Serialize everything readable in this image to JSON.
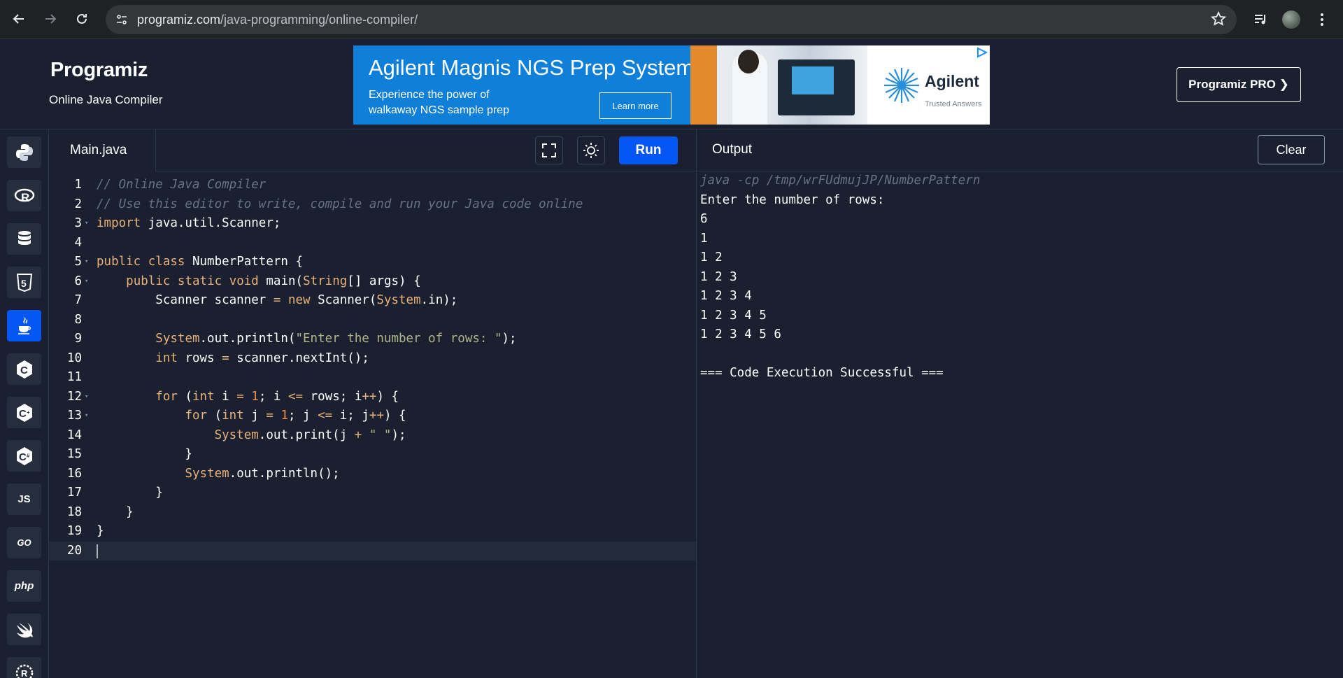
{
  "browser": {
    "url_host": "programiz.com",
    "url_path": "/java-programming/online-compiler/"
  },
  "header": {
    "logo": "Programiz",
    "subtitle": "Online Java Compiler",
    "pro_button": "Programiz PRO ❯"
  },
  "ad": {
    "title": "Agilent Magnis NGS Prep System",
    "sub_line1": "Experience the power of",
    "sub_line2": "walkaway NGS sample prep",
    "cta": "Learn more",
    "brand": "Agilent",
    "tagline": "Trusted Answers"
  },
  "sidebar": {
    "languages": [
      {
        "name": "python",
        "label": ""
      },
      {
        "name": "r",
        "label": "R"
      },
      {
        "name": "sql",
        "label": ""
      },
      {
        "name": "html",
        "label": "5"
      },
      {
        "name": "java",
        "label": ""
      },
      {
        "name": "c",
        "label": "C"
      },
      {
        "name": "cpp",
        "label": "C"
      },
      {
        "name": "csharp",
        "label": "C"
      },
      {
        "name": "javascript",
        "label": "JS"
      },
      {
        "name": "go",
        "label": "GO"
      },
      {
        "name": "php",
        "label": "php"
      },
      {
        "name": "swift",
        "label": ""
      },
      {
        "name": "rust",
        "label": "R"
      }
    ],
    "active": "java"
  },
  "editor": {
    "tab": "Main.java",
    "run_label": "Run",
    "lines": [
      [
        [
          "cm",
          "// Online Java Compiler"
        ]
      ],
      [
        [
          "cm",
          "// Use this editor to write, compile and run your Java code online"
        ]
      ],
      [
        [
          "kw",
          "import"
        ],
        [
          "pl",
          " java.util.Scanner;"
        ]
      ],
      [],
      [
        [
          "kw",
          "public"
        ],
        [
          "pl",
          " "
        ],
        [
          "kw",
          "class"
        ],
        [
          "pl",
          " NumberPattern {"
        ]
      ],
      [
        [
          "pl",
          "    "
        ],
        [
          "kw",
          "public"
        ],
        [
          "pl",
          " "
        ],
        [
          "kw",
          "static"
        ],
        [
          "pl",
          " "
        ],
        [
          "kw",
          "void"
        ],
        [
          "pl",
          " main("
        ],
        [
          "ty",
          "String"
        ],
        [
          "pl",
          "[] args) {"
        ]
      ],
      [
        [
          "pl",
          "        Scanner scanner "
        ],
        [
          "op",
          "="
        ],
        [
          "pl",
          " "
        ],
        [
          "kw",
          "new"
        ],
        [
          "pl",
          " Scanner("
        ],
        [
          "cls",
          "System"
        ],
        [
          "pl",
          ".in);"
        ]
      ],
      [],
      [
        [
          "pl",
          "        "
        ],
        [
          "cls",
          "System"
        ],
        [
          "pl",
          ".out.println("
        ],
        [
          "str",
          "\"Enter the number of rows: \""
        ],
        [
          "pl",
          ");"
        ]
      ],
      [
        [
          "pl",
          "        "
        ],
        [
          "ty",
          "int"
        ],
        [
          "pl",
          " rows "
        ],
        [
          "op",
          "="
        ],
        [
          "pl",
          " scanner.nextInt();"
        ]
      ],
      [],
      [
        [
          "pl",
          "        "
        ],
        [
          "kw",
          "for"
        ],
        [
          "pl",
          " ("
        ],
        [
          "ty",
          "int"
        ],
        [
          "pl",
          " i "
        ],
        [
          "op",
          "="
        ],
        [
          "pl",
          " "
        ],
        [
          "num",
          "1"
        ],
        [
          "pl",
          "; i "
        ],
        [
          "op",
          "<="
        ],
        [
          "pl",
          " rows; i"
        ],
        [
          "op",
          "++"
        ],
        [
          "pl",
          ") {"
        ]
      ],
      [
        [
          "pl",
          "            "
        ],
        [
          "kw",
          "for"
        ],
        [
          "pl",
          " ("
        ],
        [
          "ty",
          "int"
        ],
        [
          "pl",
          " j "
        ],
        [
          "op",
          "="
        ],
        [
          "pl",
          " "
        ],
        [
          "num",
          "1"
        ],
        [
          "pl",
          "; j "
        ],
        [
          "op",
          "<="
        ],
        [
          "pl",
          " i; j"
        ],
        [
          "op",
          "++"
        ],
        [
          "pl",
          ") {"
        ]
      ],
      [
        [
          "pl",
          "                "
        ],
        [
          "cls",
          "System"
        ],
        [
          "pl",
          ".out.print(j "
        ],
        [
          "op",
          "+"
        ],
        [
          "pl",
          " "
        ],
        [
          "str",
          "\" \""
        ],
        [
          "pl",
          ");"
        ]
      ],
      [
        [
          "pl",
          "            }"
        ]
      ],
      [
        [
          "pl",
          "            "
        ],
        [
          "cls",
          "System"
        ],
        [
          "pl",
          ".out.println();"
        ]
      ],
      [
        [
          "pl",
          "        }"
        ]
      ],
      [
        [
          "pl",
          "    }"
        ]
      ],
      [
        [
          "pl",
          "}"
        ]
      ],
      []
    ],
    "fold_lines": [
      3,
      5,
      6,
      12,
      13
    ],
    "current_line": 20
  },
  "output": {
    "title": "Output",
    "clear_label": "Clear",
    "command": "java -cp /tmp/wrFUdmujJP/NumberPattern",
    "lines": [
      "Enter the number of rows:",
      "6",
      "1",
      "1 2",
      "1 2 3",
      "1 2 3 4",
      "1 2 3 4 5",
      "1 2 3 4 5 6",
      "",
      "=== Code Execution Successful ==="
    ]
  }
}
